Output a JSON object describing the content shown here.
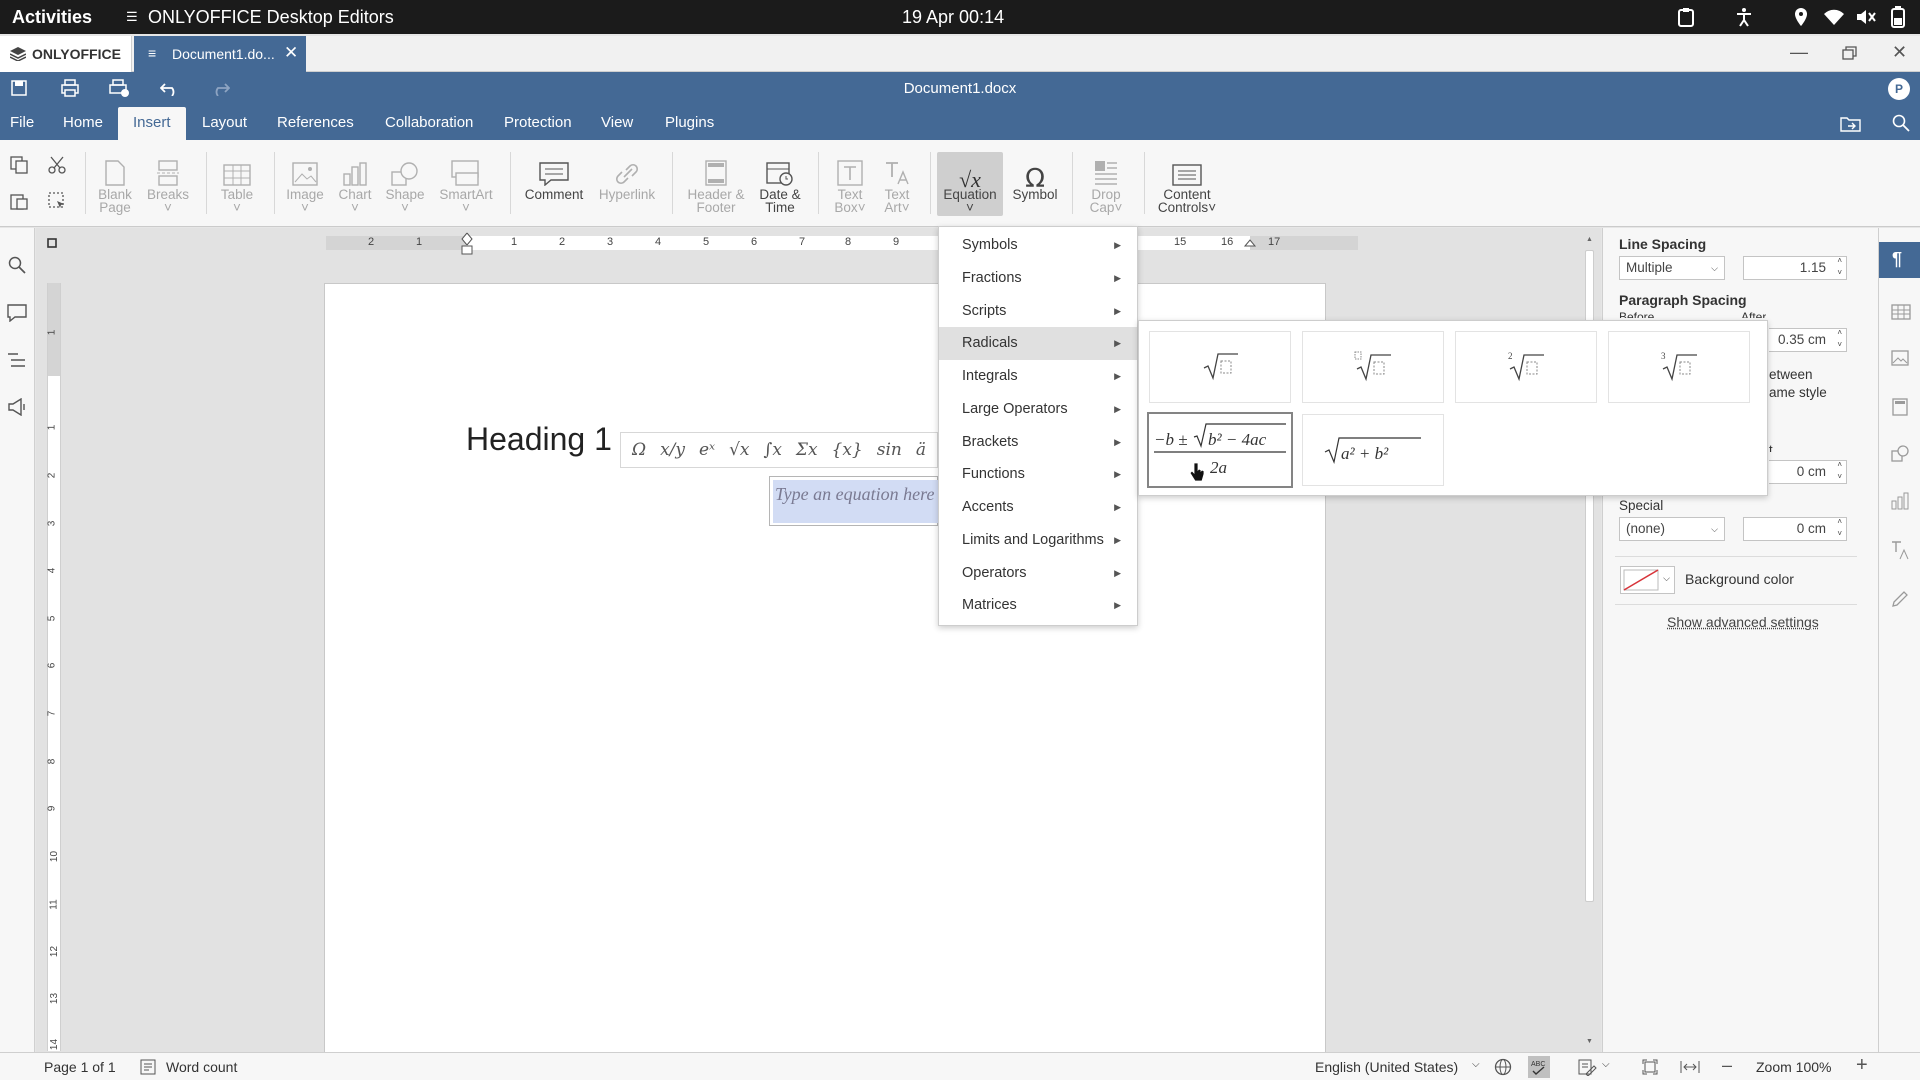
{
  "system_bar": {
    "activities": "Activities",
    "app_name": "ONLYOFFICE Desktop Editors",
    "datetime": "19 Apr  00:14"
  },
  "tabs": {
    "brand": "ONLYOFFICE",
    "doc_tab": "Document1.do..."
  },
  "header": {
    "title": "Document1.docx",
    "avatar_initial": "P"
  },
  "menu_tabs": [
    "File",
    "Home",
    "Insert",
    "Layout",
    "References",
    "Collaboration",
    "Protection",
    "View",
    "Plugins"
  ],
  "active_tab": "Insert",
  "toolbar": {
    "blank_page": [
      "Blank",
      "Page"
    ],
    "breaks": "Breaks",
    "table": "Table",
    "image": "Image",
    "chart": "Chart",
    "shape": "Shape",
    "smartart": "SmartArt",
    "comment": "Comment",
    "hyperlink": "Hyperlink",
    "header_footer": [
      "Header &",
      "Footer"
    ],
    "date_time": [
      "Date &",
      "Time"
    ],
    "text_box": [
      "Text",
      "Box"
    ],
    "text_art": [
      "Text",
      "Art"
    ],
    "equation": "Equation",
    "symbol": "Symbol",
    "drop_cap": [
      "Drop",
      "Cap"
    ],
    "content_controls": [
      "Content",
      "Controls"
    ]
  },
  "ruler": {
    "ticks": [
      "2",
      "1",
      "1",
      "2",
      "3",
      "4",
      "5",
      "6",
      "7",
      "8",
      "9",
      "15",
      "16",
      "17"
    ]
  },
  "vruler": {
    "ticks": [
      "1",
      "1",
      "2",
      "3",
      "4",
      "5",
      "6",
      "7",
      "8",
      "9",
      "10",
      "11",
      "12",
      "13",
      "14"
    ]
  },
  "document": {
    "heading": "Heading 1",
    "equation_placeholder": "Type an equation here"
  },
  "equation_toolbar": [
    "Ω",
    "x/y",
    "eˣ",
    "√x",
    "∫x",
    "Σx",
    "{x}",
    "sin",
    "ä"
  ],
  "equation_menu": {
    "items": [
      "Symbols",
      "Fractions",
      "Scripts",
      "Radicals",
      "Integrals",
      "Large Operators",
      "Brackets",
      "Functions",
      "Accents",
      "Limits and Logarithms",
      "Operators",
      "Matrices"
    ],
    "highlighted": "Radicals"
  },
  "radicals": {
    "degree_two": "2",
    "degree_three": "3",
    "quadratic": {
      "numerator_left": "−b ±",
      "numerator_radicand": "b² − 4ac",
      "denominator": "2a"
    },
    "hypotenuse": "a² + b²"
  },
  "right_panel": {
    "line_spacing_label": "Line Spacing",
    "line_spacing_type": "Multiple",
    "line_spacing_value": "1.15",
    "paragraph_spacing_label": "Paragraph Spacing",
    "before_label": "Before",
    "after_label": "After",
    "after_value": "0.35 cm",
    "checkbox_text_a": "etween",
    "checkbox_text_b": "ame style",
    "indent_label": "t",
    "indent_value": "0 cm",
    "special_label": "Special",
    "special_value": "(none)",
    "special_amount": "0 cm",
    "background_color_label": "Background color",
    "advanced_link": "Show advanced settings"
  },
  "status_bar": {
    "page": "Page 1 of 1",
    "word_count": "Word count",
    "language": "English (United States)",
    "zoom": "Zoom 100%"
  },
  "colors": {
    "header_blue": "#446995",
    "selection": "#d2dcf4"
  }
}
